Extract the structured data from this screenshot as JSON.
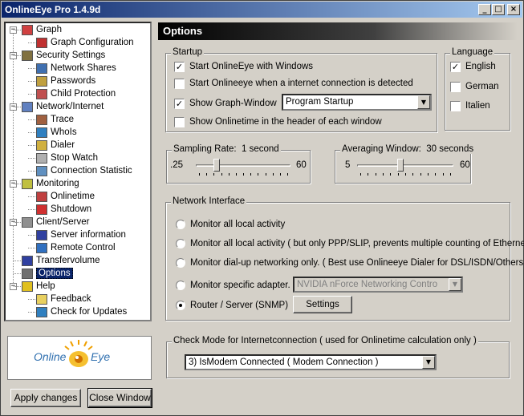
{
  "window": {
    "title": "OnlineEye Pro 1.4.9d",
    "controls": {
      "minimize": "_",
      "maximize": "□",
      "close": "×"
    }
  },
  "tree": {
    "items": [
      {
        "label": "Graph",
        "icon": "graph-icon",
        "expanded": true
      },
      {
        "label": "Graph Configuration",
        "icon": "bar-chart-icon"
      },
      {
        "label": "Security Settings",
        "icon": "security-icon",
        "expanded": true
      },
      {
        "label": "Network Shares",
        "icon": "network-share-icon"
      },
      {
        "label": "Passwords",
        "icon": "password-icon"
      },
      {
        "label": "Child Protection",
        "icon": "child-protection-icon"
      },
      {
        "label": "Network/Internet",
        "icon": "computer-icon",
        "expanded": true
      },
      {
        "label": "Trace",
        "icon": "trace-icon"
      },
      {
        "label": "WhoIs",
        "icon": "globe-icon"
      },
      {
        "label": "Dialer",
        "icon": "dialer-icon"
      },
      {
        "label": "Stop Watch",
        "icon": "stopwatch-icon"
      },
      {
        "label": "Connection Statistic",
        "icon": "statistic-icon"
      },
      {
        "label": "Monitoring",
        "icon": "monitoring-icon",
        "expanded": true
      },
      {
        "label": "Onlinetime",
        "icon": "alarm-clock-icon"
      },
      {
        "label": "Shutdown",
        "icon": "shutdown-icon"
      },
      {
        "label": "Client/Server",
        "icon": "client-server-icon",
        "expanded": true
      },
      {
        "label": "Server information",
        "icon": "sigma-icon"
      },
      {
        "label": "Remote Control",
        "icon": "remote-control-icon"
      },
      {
        "label": "Transfervolume",
        "icon": "sigma-icon"
      },
      {
        "label": "Options",
        "icon": "options-icon",
        "selected": true
      },
      {
        "label": "Help",
        "icon": "help-icon",
        "expanded": true
      },
      {
        "label": "Feedback",
        "icon": "envelope-icon"
      },
      {
        "label": "Check for Updates",
        "icon": "update-globe-icon"
      }
    ]
  },
  "logo": {
    "left": "Online",
    "right": "Eye"
  },
  "buttons": {
    "apply": "Apply changes",
    "close": "Close Window"
  },
  "options": {
    "header": "Options",
    "startup": {
      "title": "Startup",
      "start_with_windows": {
        "label": "Start OnlineEye with Windows",
        "checked": true
      },
      "start_on_connect": {
        "label": "Start Onlineeye when a internet connection is detected",
        "checked": false
      },
      "show_graph": {
        "label": "Show Graph-Window",
        "checked": true
      },
      "graph_mode": "Program Startup",
      "show_onlinetime": {
        "label": "Show Onlinetime in the header of each window",
        "checked": false
      }
    },
    "language": {
      "title": "Language",
      "english": {
        "label": "English",
        "checked": true
      },
      "german": {
        "label": "German",
        "checked": false
      },
      "italien": {
        "label": "Italien",
        "checked": false
      }
    },
    "sampling": {
      "title": "Sampling Rate:",
      "value": "1 second",
      "min": ".25",
      "max": "60",
      "level": 0.2
    },
    "averaging": {
      "title": "Averaging Window:",
      "value": "30 seconds",
      "min": "5",
      "max": "60",
      "level": 0.45
    },
    "network": {
      "title": "Network Interface",
      "options": [
        {
          "label": "Monitor all local activity",
          "selected": false
        },
        {
          "label": "Monitor all local activity ( but only PPP/SLIP, prevents multiple counting of Ethernet )",
          "selected": false
        },
        {
          "label": "Monitor dial-up networking only. ( Best use Onlineeye Dialer for DSL/ISDN/Others )",
          "selected": false
        },
        {
          "label": "Monitor specific adapter.",
          "selected": false
        },
        {
          "label": "Router / Server (SNMP)",
          "selected": true
        }
      ],
      "adapter": "NVIDIA nForce Networking Contro",
      "settings_button": "Settings"
    },
    "checkmode": {
      "title": "Check Mode for Internetconnection ( used for Onlinetime calculation only )",
      "value": "3) IsModem Connected ( Modem Connection )"
    }
  }
}
